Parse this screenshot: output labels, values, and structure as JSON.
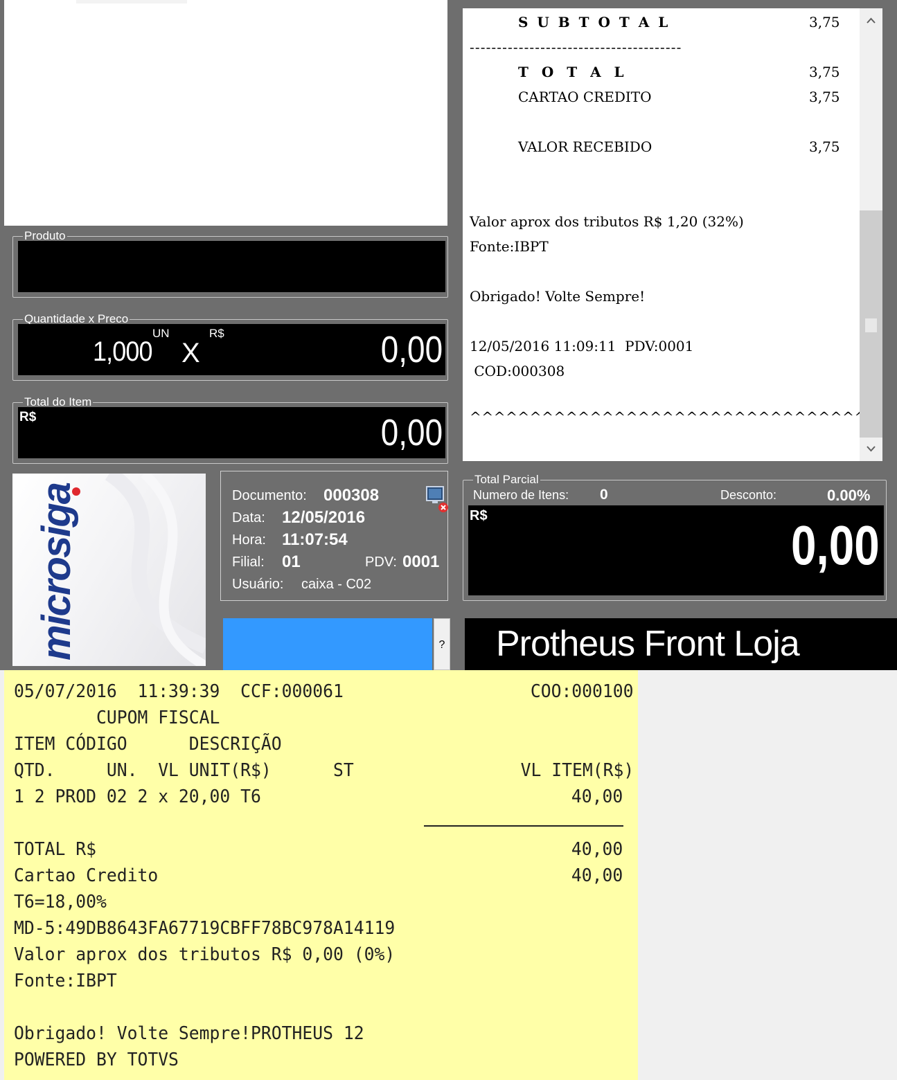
{
  "produto": {
    "legend": "Produto",
    "value": ""
  },
  "quantidade": {
    "legend": "Quantidade x Preco",
    "qty": "1,000",
    "unit": "UN",
    "times": "X",
    "currency": "R$",
    "price": "0,00"
  },
  "total_item": {
    "legend": "Total do Item",
    "currency": "R$",
    "value": "0,00"
  },
  "receipt_panel": {
    "subtotal_label": "S U B T O T A L",
    "subtotal_value": "3,75",
    "dashes": "---------------------------------------",
    "total_label": "T O T A L",
    "total_value": "3,75",
    "cartao_label": "CARTAO CREDITO",
    "cartao_value": "3,75",
    "recebido_label": "VALOR RECEBIDO",
    "recebido_value": "3,75",
    "tributos": "Valor aprox dos tributos R$ 1,20 (32%)",
    "fonte": "Fonte:IBPT",
    "obrigado": "Obrigado! Volte Sempre!",
    "datetime": "12/05/2016 11:09:11  PDV:0001",
    "cod": " COD:000308",
    "carets": "^^^^^^^^^^^^^^^^^^^^^^^^^^^^^^^^^^^^^^^"
  },
  "logo": {
    "text": "microsiga"
  },
  "info": {
    "documento_label": "Documento:",
    "documento_value": "000308",
    "data_label": "Data:",
    "data_value": "12/05/2016",
    "hora_label": "Hora:",
    "hora_value": "11:07:54",
    "filial_label": "Filial:",
    "filial_value": "01",
    "pdv_label": "PDV:",
    "pdv_value": "0001",
    "usuario_label": "Usuário:",
    "usuario_value": "caixa - C02"
  },
  "total_parcial": {
    "legend": "Total Parcial",
    "itens_label": "Numero de Itens:",
    "itens_value": "0",
    "desconto_label": "Desconto:",
    "desconto_value": "0.00%",
    "currency": "R$",
    "value": "0,00"
  },
  "footer": {
    "help": "?",
    "brand": "Protheus Front Loja"
  },
  "cupom": {
    "header_left": "05/07/2016  11:39:39  CCF:000061",
    "header_right": "COO:000100",
    "title": "        CUPOM FISCAL",
    "cols1": "ITEM CÓDIGO      DESCRIÇÃO",
    "cols2_left": "QTD.     UN.  VL UNIT(R$)      ST",
    "cols2_right": "VL ITEM(R$)",
    "item_line": "1 2 PROD 02 2 x 20,00 T6",
    "item_value": "40,00",
    "total_label": "TOTAL R$",
    "total_value": "40,00",
    "cartao_label": "Cartao Credito",
    "cartao_value": "40,00",
    "aliquota": "T6=18,00%",
    "md5": "MD-5:49DB8643FA67719CBFF78BC978A14119",
    "tributos": "Valor aprox dos tributos R$ 0,00 (0%)",
    "fonte": "Fonte:IBPT",
    "obrigado": "Obrigado! Volte Sempre!PROTHEUS 12",
    "powered": "POWERED BY TOTVS"
  }
}
